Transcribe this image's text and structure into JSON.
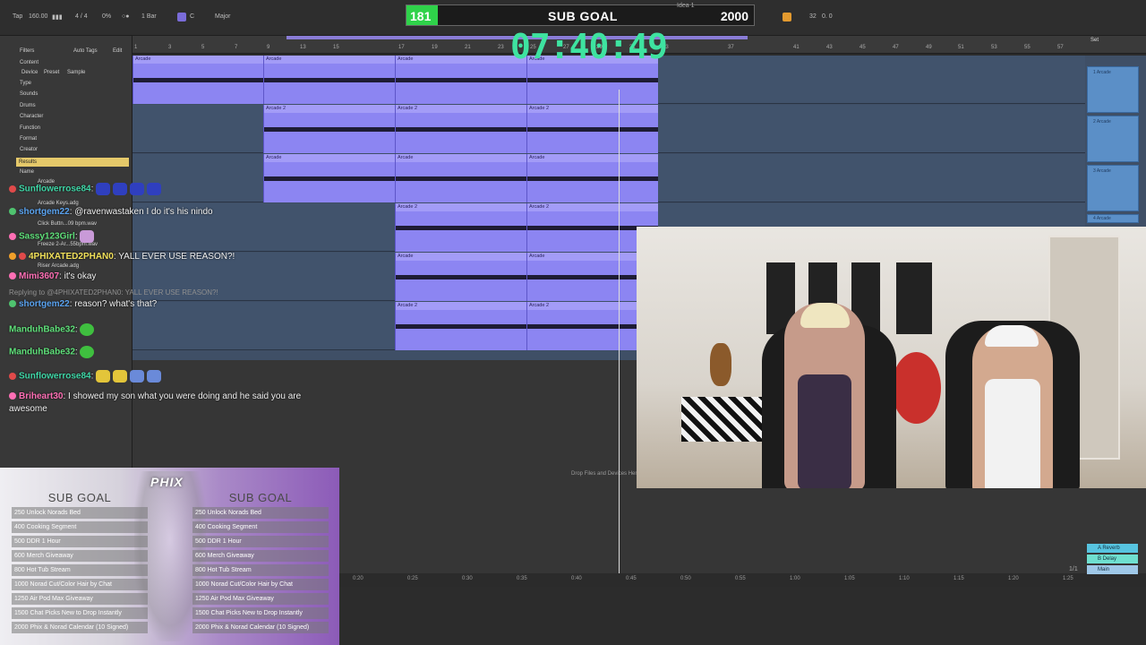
{
  "topbar": {
    "tap": "Tap",
    "bpm": "160.00",
    "signature": "4 / 4",
    "percent": "0%",
    "bar_length": "1 Bar",
    "key": "C",
    "scale": "Major",
    "sample_rate": "32",
    "display_values": "0. 0"
  },
  "sub_goal_bar": {
    "current": "181",
    "label": "SUB GOAL",
    "goal": "2000",
    "progress": 0.0905
  },
  "idea_label": "Idea 1",
  "timer": "07:40:49",
  "browser": {
    "filters": "Filters",
    "auto_tags": "Auto Tags",
    "edit": "Edit",
    "content": "Content",
    "device": "Device",
    "preset": "Preset",
    "sample": "Sample",
    "type": "Type",
    "sounds": "Sounds",
    "drums": "Drums",
    "character": "Character",
    "function": "Function",
    "format": "Format",
    "creator": "Creator",
    "results": "Results",
    "name_col": "Name",
    "items": [
      "Arcade",
      "Arcade Keys.adg",
      "Click Buttn...09 bpm.wav",
      "Freeze 2-Ar...55bpm.wav",
      "Riser Arcade.adg"
    ]
  },
  "ruler": {
    "marks": [
      "1",
      "3",
      "5",
      "7",
      "9",
      "13",
      "15",
      "17",
      "19",
      "21",
      "23",
      "25",
      "27",
      "29",
      "31",
      "33",
      "37",
      "41",
      "43",
      "45",
      "47",
      "49",
      "51",
      "53",
      "55",
      "57"
    ],
    "set_label": "Set"
  },
  "clips": {
    "arcade": "Arcade",
    "arcade2": "Arcade 2"
  },
  "tracks": [
    "1 Arcade",
    "2 Arcade",
    "3 Arcade",
    "4 Arcade"
  ],
  "drop_label": "Drop Files and Devices Here",
  "timeline": [
    "0:20",
    "0:25",
    "0:30",
    "0:35",
    "0:40",
    "0:45",
    "0:50",
    "0:55",
    "1:00",
    "1:05",
    "1:10",
    "1:15",
    "1:20",
    "1:25"
  ],
  "returns": {
    "a": "A Reverb",
    "b": "B Delay",
    "main": "Main",
    "zoom": "1/1"
  },
  "chat": [
    {
      "user": "Sunflowerrose84",
      "text": "",
      "color": "#3ed6a6"
    },
    {
      "user": "shortgem22",
      "text": "@ravenwastaken I do it's his nindo",
      "color": "#5aa3f0"
    },
    {
      "user": "Sassy123Girl",
      "text": "",
      "color": "#5fe07a"
    },
    {
      "user": "4PHIXATED2PHAN0",
      "text": "YALL EVER USE REASON?!",
      "color": "#f1e05a"
    },
    {
      "user": "Mimi3607",
      "text": "it's okay",
      "color": "#ff6fb5"
    },
    {
      "user": "shortgem22",
      "text": "reason? what's that?",
      "color": "#5aa3f0"
    },
    {
      "user": "ManduhBabe32",
      "text": "",
      "color": "#5fe07a"
    },
    {
      "user": "ManduhBabe32",
      "text": "",
      "color": "#5fe07a"
    },
    {
      "user": "Sunflowerrose84",
      "text": "",
      "color": "#3ed6a6"
    },
    {
      "user": "Briheart30",
      "text": "I showed my son what you were doing and he said you are",
      "text2": "awesome",
      "color": "#ff6fb5"
    }
  ],
  "chat_reply": "Replying to @4PHIXATED2PHAN0: YALL EVER USE REASON?!",
  "goal_panel": {
    "logo": "PHIX",
    "title_left": "SUB GOAL",
    "title_right": "SUB GOAL",
    "goals": [
      "250 Unlock Norads Bed",
      "400 Cooking Segment",
      "500 DDR 1 Hour",
      "600 Merch Giveaway",
      "800 Hot Tub Stream",
      "1000 Norad Cut/Color Hair by Chat",
      "1250 Air Pod Max Giveaway",
      "1500 Chat Picks New to Drop Instantly",
      "2000 Phix & Norad Calendar (10 Signed)"
    ]
  }
}
